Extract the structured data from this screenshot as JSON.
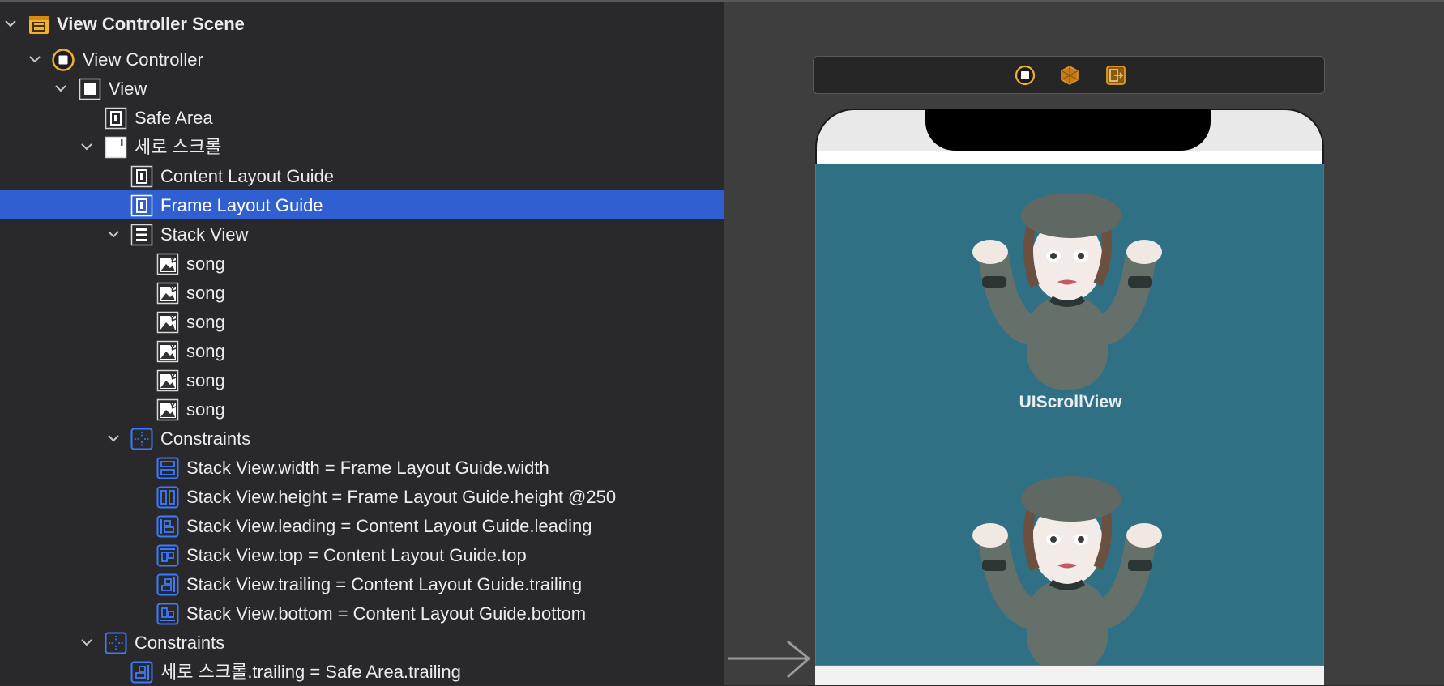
{
  "outline": {
    "rows": [
      {
        "label": "View Controller Scene"
      },
      {
        "label": "View Controller"
      },
      {
        "label": "View"
      },
      {
        "label": "Safe Area"
      },
      {
        "label": "세로 스크롤"
      },
      {
        "label": "Content Layout Guide"
      },
      {
        "label": "Frame Layout Guide"
      },
      {
        "label": "Stack View"
      },
      {
        "label": "song"
      },
      {
        "label": "song"
      },
      {
        "label": "song"
      },
      {
        "label": "song"
      },
      {
        "label": "song"
      },
      {
        "label": "song"
      },
      {
        "label": "Constraints"
      },
      {
        "label": "Stack View.width = Frame Layout Guide.width"
      },
      {
        "label": "Stack View.height = Frame Layout Guide.height @250"
      },
      {
        "label": "Stack View.leading = Content Layout Guide.leading"
      },
      {
        "label": "Stack View.top = Content Layout Guide.top"
      },
      {
        "label": "Stack View.trailing = Content Layout Guide.trailing"
      },
      {
        "label": "Stack View.bottom = Content Layout Guide.bottom"
      },
      {
        "label": "Constraints"
      },
      {
        "label": "세로 스크롤.trailing = Safe Area.trailing"
      }
    ]
  },
  "canvas": {
    "scene_bar_icons": [
      "view-controller-icon",
      "first-responder-icon",
      "exit-icon"
    ],
    "images": [
      {
        "caption": "UIScrollView"
      },
      {
        "caption": ""
      }
    ]
  },
  "colors": {
    "selection": "#2f5fd0",
    "scroll_background": "#2f7085",
    "constraint_icon": "#3b7bff",
    "scene_icon": "#f0b030"
  }
}
